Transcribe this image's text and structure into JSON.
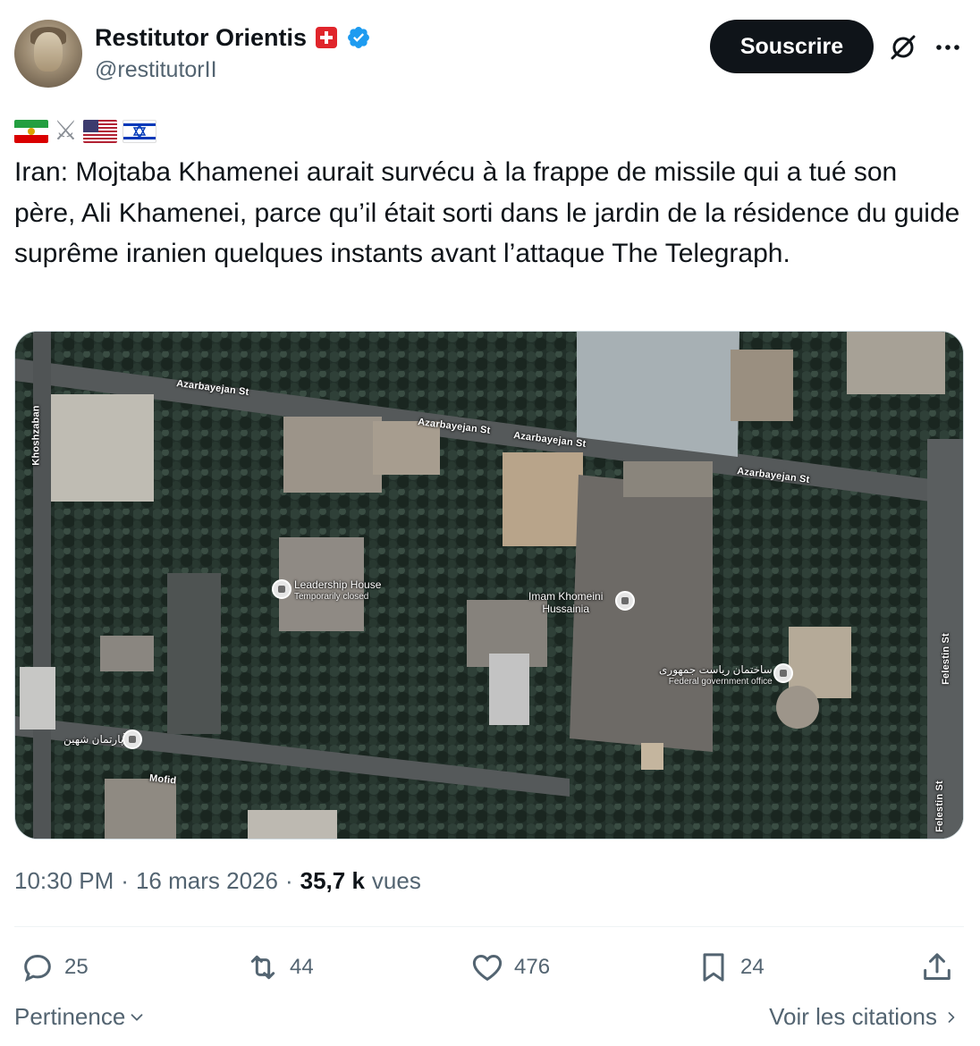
{
  "author": {
    "display_name": "Restitutor Orientis",
    "handle": "@restitutorII"
  },
  "header": {
    "subscribe_label": "Souscrire"
  },
  "tweet": {
    "flag_emojis": [
      "iran-flag",
      "crossed-swords",
      "usa-flag",
      "israel-flag"
    ],
    "text": "Iran: Mojtaba Khamenei aurait survécu à la frappe de missile qui a tué son père, Ali Khamenei, parce qu’il était sorti dans le jardin de la résidence du guide suprême iranien quelques instants avant l’attaque The Telegraph."
  },
  "map": {
    "labels": {
      "azarbayejan_1": "Azarbayejan St",
      "azarbayejan_2": "Azarbayejan St",
      "azarbayejan_3": "Azarbayejan St",
      "azarbayejan_4": "Azarbayejan St",
      "khoshzaban": "Khoshzaban",
      "mofid": "Mofid",
      "felestin_1": "Felestin St",
      "felestin_2": "Felestin St"
    },
    "pois": {
      "leadership_name": "Leadership House",
      "leadership_status": "Temporarily closed",
      "hussainia_line1": "Imam Khomeini",
      "hussainia_line2": "Hussainia",
      "federal_farsi": "ساختمان ریاست جمهوری",
      "federal_name": "Federal government office",
      "apartment_farsi": "آپارتمان شهین"
    }
  },
  "meta": {
    "time": "10:30 PM",
    "separator": "·",
    "date": "16 mars 2026",
    "separator2": "·",
    "views_count": "35,7 k",
    "views_label": "vues"
  },
  "actions": {
    "replies": "25",
    "reposts": "44",
    "likes": "476",
    "bookmarks": "24"
  },
  "footer": {
    "sort_label": "Pertinence",
    "quotes_label": "Voir les citations"
  },
  "colors": {
    "verified_blue": "#1d9bf0",
    "text_primary": "#0f1419",
    "text_secondary": "#536471"
  }
}
